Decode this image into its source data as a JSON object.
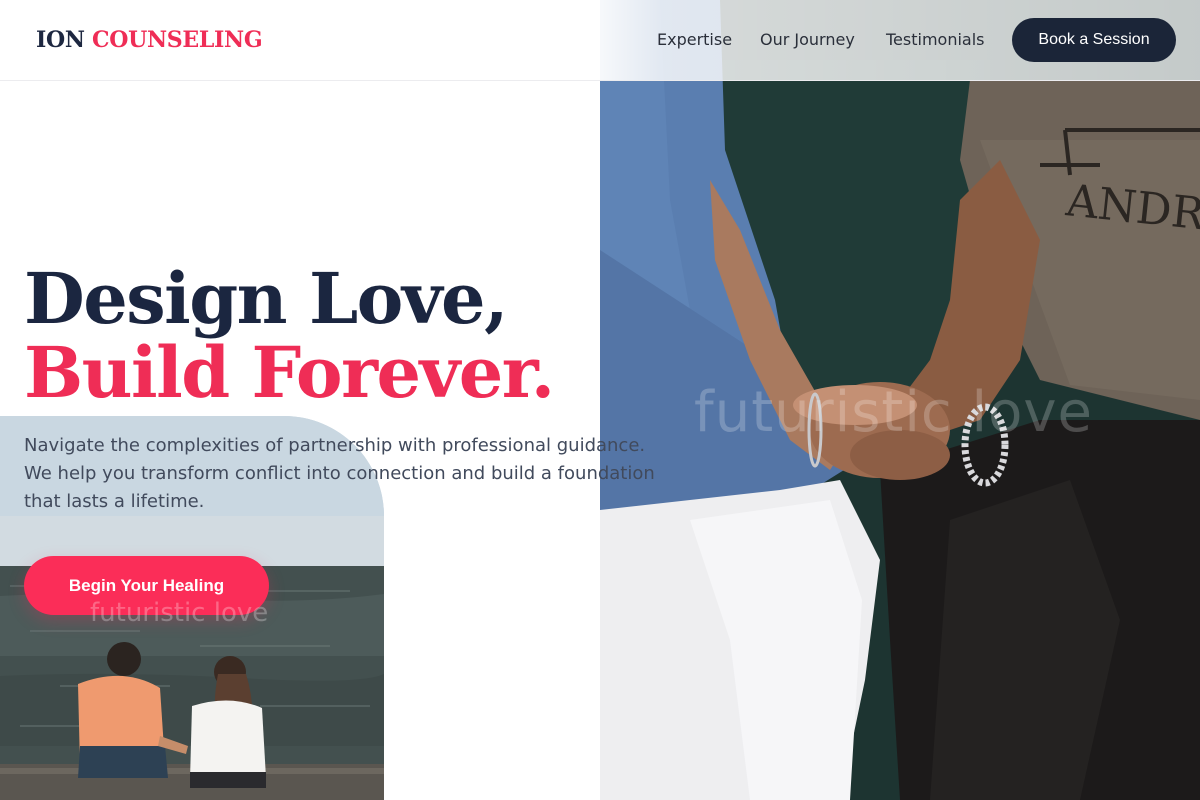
{
  "header": {
    "logo_part1": "ION",
    "logo_part2": "COUNSELING",
    "nav": [
      {
        "label": "Expertise"
      },
      {
        "label": "Our Journey"
      },
      {
        "label": "Testimonials"
      }
    ],
    "cta_label": "Book a Session"
  },
  "hero": {
    "headline_line1": "Design Love,",
    "headline_line2": "Build Forever.",
    "subtext_lines": [
      "Navigate the complexities of partnership with professional guidance.",
      "We help you transform conflict into connection and build a foundation",
      "that lasts a lifetime."
    ],
    "cta_label": "Begin Your Healing"
  },
  "watermark": "futuristic love",
  "photos": {
    "main_shirt_text": "ANDRE"
  },
  "colors": {
    "navy": "#1b2640",
    "accent_pink": "#ef2d56",
    "button_pink": "#fb2d58",
    "button_dark": "#1b2538",
    "body_text": "#414a5c"
  }
}
